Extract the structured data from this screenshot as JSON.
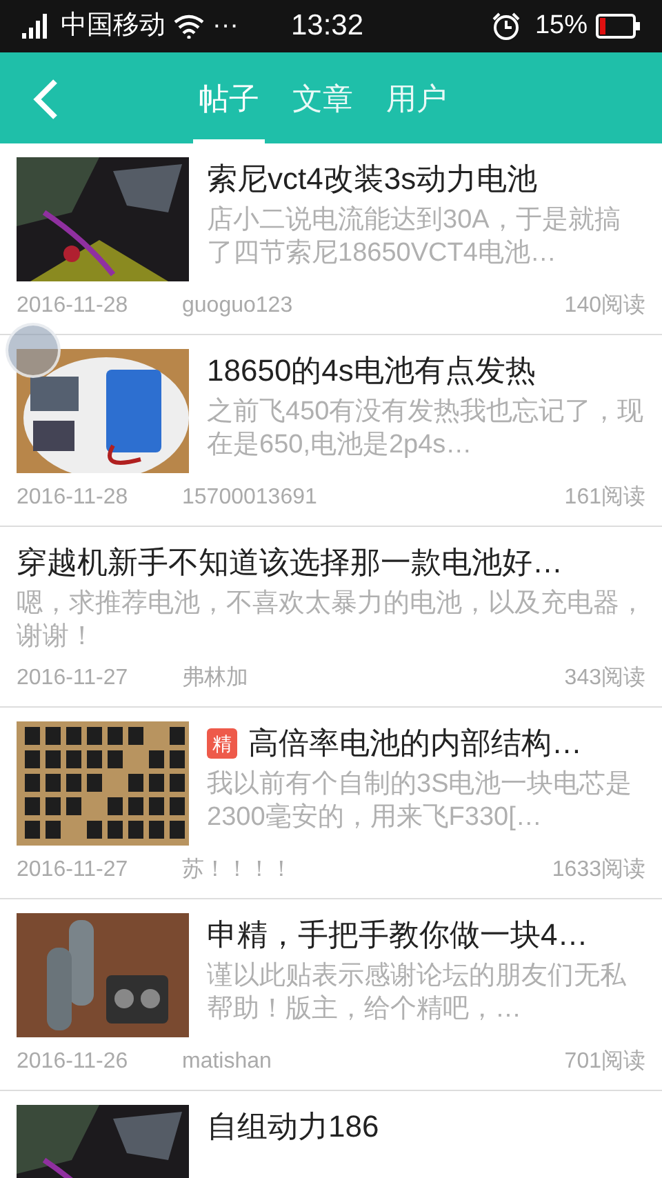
{
  "status_bar": {
    "carrier": "中国移动",
    "more": "···",
    "time": "13:32",
    "battery": "15%"
  },
  "tabs": [
    {
      "label": "帖子",
      "selected": true
    },
    {
      "label": "文章",
      "selected": false
    },
    {
      "label": "用户",
      "selected": false
    }
  ],
  "posts": [
    {
      "kind": "with_image",
      "title": "索尼vct4改装3s动力电池",
      "excerpt": "店小二说电流能达到30A，于是就搞了四节索尼18650VCT4电池…",
      "date": "2016-11-28",
      "author": "guoguo123",
      "reads": "140阅读"
    },
    {
      "kind": "with_image",
      "title": "18650的4s电池有点发热",
      "excerpt": "之前飞450有没有发热我也忘记了，现在是650,电池是2p4s…",
      "date": "2016-11-28",
      "author": "15700013691",
      "reads": "161阅读"
    },
    {
      "kind": "text_only",
      "title": "穿越机新手不知道该选择那一款电池好…",
      "excerpt": "嗯，求推荐电池，不喜欢太暴力的电池，以及充电器，谢谢！",
      "date": "2016-11-27",
      "author": "弗林加",
      "reads": "343阅读"
    },
    {
      "kind": "with_image",
      "badge": "精",
      "title": "高倍率电池的内部结构…",
      "excerpt": "我以前有个自制的3S电池一块电芯是2300毫安的，用来飞F330[…",
      "date": "2016-11-27",
      "author": "苏！！！！",
      "reads": "1633阅读"
    },
    {
      "kind": "with_image",
      "title": "申精，手把手教你做一块4…",
      "excerpt": "谨以此贴表示感谢论坛的朋友们无私帮助！版主，给个精吧，…",
      "date": "2016-11-26",
      "author": "matishan",
      "reads": "701阅读"
    },
    {
      "kind": "with_image",
      "title": "自组动力186"
    }
  ]
}
